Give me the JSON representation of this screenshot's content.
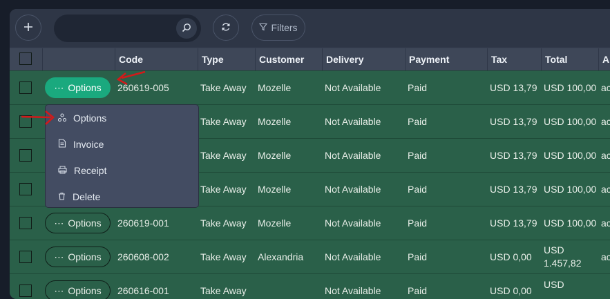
{
  "toolbar": {
    "filters_label": "Filters"
  },
  "table": {
    "headers": [
      "Code",
      "Type",
      "Customer",
      "Delivery",
      "Payment",
      "Tax",
      "Total",
      "A"
    ],
    "rows": [
      {
        "options": "Options",
        "code": "260619-005",
        "type": "Take Away",
        "customer": "Mozelle",
        "delivery": "Not Available",
        "payment": "Paid",
        "tax": "USD 13,79",
        "total": "USD 100,00",
        "extra": "ac"
      },
      {
        "options": "",
        "code": "",
        "type": "Take Away",
        "customer": "Mozelle",
        "delivery": "Not Available",
        "payment": "Paid",
        "tax": "USD 13,79",
        "total": "USD 100,00",
        "extra": "ac"
      },
      {
        "options": "",
        "code": "",
        "type": "Take Away",
        "customer": "Mozelle",
        "delivery": "Not Available",
        "payment": "Paid",
        "tax": "USD 13,79",
        "total": "USD 100,00",
        "extra": "ac"
      },
      {
        "options": "",
        "code": "",
        "type": "Take Away",
        "customer": "Mozelle",
        "delivery": "Not Available",
        "payment": "Paid",
        "tax": "USD 13,79",
        "total": "USD 100,00",
        "extra": "ac"
      },
      {
        "options": "Options",
        "code": "260619-001",
        "type": "Take Away",
        "customer": "Mozelle",
        "delivery": "Not Available",
        "payment": "Paid",
        "tax": "USD 13,79",
        "total": "USD 100,00",
        "extra": "ac"
      },
      {
        "options": "Options",
        "code": "260608-002",
        "type": "Take Away",
        "customer": "Alexandria",
        "delivery": "Not Available",
        "payment": "Paid",
        "tax": "USD 0,00",
        "total_line1": "USD",
        "total_line2": "1.457,82",
        "extra": "ac"
      },
      {
        "options": "Options",
        "code": "260616-001",
        "type": "Take Away",
        "customer": "",
        "delivery": "Not Available",
        "payment": "Paid",
        "tax": "USD 0,00",
        "total_line1": "USD",
        "total_line2": "",
        "extra": ""
      }
    ]
  },
  "options_menu": {
    "items": [
      {
        "label": "Options",
        "icon": "sitemap-icon"
      },
      {
        "label": "Invoice",
        "icon": "invoice-icon"
      },
      {
        "label": "Receipt",
        "icon": "printer-icon"
      },
      {
        "label": "Delete",
        "icon": "trash-icon"
      }
    ]
  },
  "colors": {
    "row_bg": "#2a6049",
    "active_button": "#1aa97e",
    "annotation_arrow": "#d11a1a"
  }
}
